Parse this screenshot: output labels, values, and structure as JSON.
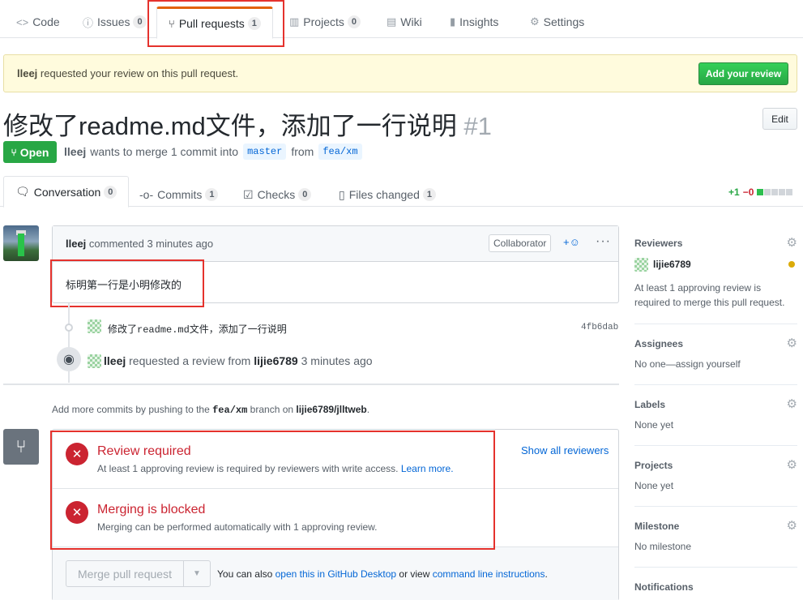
{
  "reponav": {
    "code": "Code",
    "issues": "Issues",
    "issues_count": "0",
    "pulls": "Pull requests",
    "pulls_count": "1",
    "projects": "Projects",
    "projects_count": "0",
    "wiki": "Wiki",
    "insights": "Insights",
    "settings": "Settings"
  },
  "flash": {
    "user": "lleej",
    "text": "requested your review on this pull request.",
    "button": "Add your review"
  },
  "pr": {
    "title": "修改了readme.md文件，添加了一行说明",
    "number": "#1",
    "edit": "Edit",
    "state": "Open",
    "author": "lleej",
    "merge_text": "wants to merge 1 commit into",
    "base": "master",
    "from_text": "from",
    "head": "fea/xm"
  },
  "tabs": {
    "conversation": "Conversation",
    "conversation_count": "0",
    "commits": "Commits",
    "commits_count": "1",
    "checks": "Checks",
    "checks_count": "0",
    "files": "Files changed",
    "files_count": "1",
    "additions": "+1",
    "deletions": "−0"
  },
  "comment": {
    "author": "lleej",
    "action": "commented",
    "time": "3 minutes ago",
    "badge": "Collaborator",
    "body": "标明第一行是小明修改的"
  },
  "commit": {
    "message": "修改了readme.md文件，添加了一行说明",
    "sha": "4fb6dab"
  },
  "review_event": {
    "actor": "lleej",
    "text": "requested a review from",
    "reviewer": "lijie6789",
    "time": "3 minutes ago"
  },
  "push_note": {
    "prefix": "Add more commits by pushing to the",
    "branch": "fea/xm",
    "middle": "branch on",
    "repo": "lijie6789/jlltweb",
    "suffix": "."
  },
  "merge": {
    "review_title": "Review required",
    "review_desc": "At least 1 approving review is required by reviewers with write access.",
    "learn_more": "Learn more.",
    "show_all": "Show all reviewers",
    "blocked_title": "Merging is blocked",
    "blocked_desc": "Merging can be performed automatically with 1 approving review.",
    "merge_button": "Merge pull request",
    "also_prefix": "You can also",
    "open_desktop": "open this in GitHub Desktop",
    "or_view": "or view",
    "cli": "command line instructions",
    "period": "."
  },
  "sidebar": {
    "reviewers_title": "Reviewers",
    "reviewer_name": "lijie6789",
    "reviewers_note": "At least 1 approving review is required to merge this pull request.",
    "assignees_title": "Assignees",
    "assignees_text": "No one—assign yourself",
    "labels_title": "Labels",
    "labels_text": "None yet",
    "projects_title": "Projects",
    "projects_text": "None yet",
    "milestone_title": "Milestone",
    "milestone_text": "No milestone",
    "notifications_title": "Notifications"
  },
  "colors": {
    "open_green": "#28a745",
    "error_red": "#cb2431",
    "link_blue": "#0366d6",
    "highlight_box": "#e5322d",
    "pending_yellow": "#dbab09"
  },
  "icons": [
    "code-icon",
    "issue-icon",
    "pull-request-icon",
    "project-icon",
    "wiki-icon",
    "graph-icon",
    "gear-icon",
    "comment-icon",
    "commit-icon",
    "checklist-icon",
    "file-diff-icon",
    "eye-icon",
    "merge-icon",
    "x-icon",
    "smiley-icon",
    "kebab-icon",
    "triangle-down-icon"
  ]
}
